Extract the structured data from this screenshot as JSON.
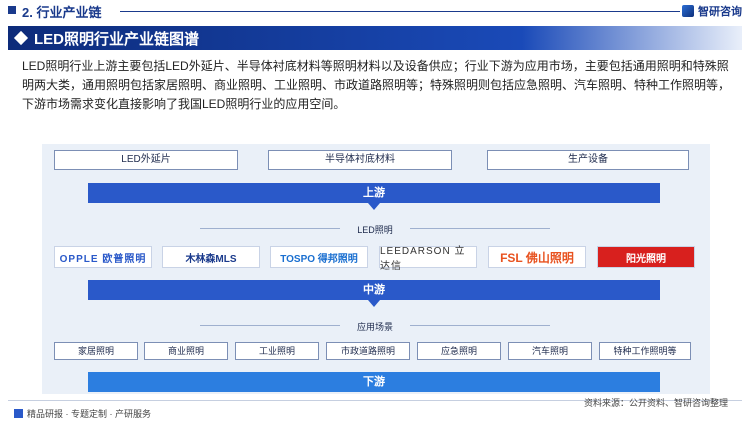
{
  "header": {
    "section": "2. 行业产业链",
    "brand": "智研咨询"
  },
  "title": "LED照明行业产业链图谱",
  "intro": "LED照明行业上游主要包括LED外延片、半导体衬底材料等照明材料以及设备供应；行业下游为应用市场，主要包括通用照明和特殊照明两大类，通用照明包括家居照明、商业照明、工业照明、市政道路照明等；特殊照明则包括应急照明、汽车照明、特种工作照明等，下游市场需求变化直接影响了我国LED照明行业的应用空间。",
  "upstream": {
    "items": [
      "LED外延片",
      "半导体衬底材料",
      "生产设备"
    ],
    "label": "上游"
  },
  "midstream": {
    "header": "LED照明",
    "logos": [
      "OPPLE 欧普照明",
      "木林森MLS",
      "TOSPO 得邦照明",
      "LEEDARSON 立达信",
      "FSL 佛山照明",
      "阳光照明"
    ],
    "label": "中游"
  },
  "downstream": {
    "header": "应用场景",
    "items": [
      "家居照明",
      "商业照明",
      "工业照明",
      "市政道路照明",
      "应急照明",
      "汽车照明",
      "特种工作照明等"
    ],
    "label": "下游"
  },
  "footer": {
    "left": "精品研报 · 专题定制 · 产研服务",
    "source": "资料来源：公开资料、智研咨询整理"
  },
  "colors": {
    "primary": "#1a3a8c",
    "stage": "#2a59c9",
    "panel": "#eaf0f8"
  }
}
